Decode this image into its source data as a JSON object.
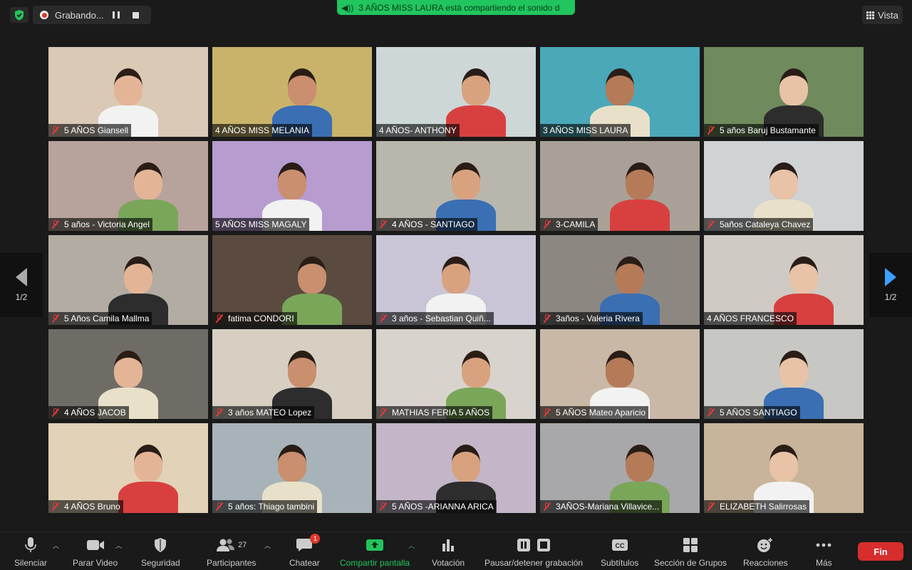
{
  "top": {
    "recording_label": "Grabando...",
    "share_banner": "3 AÑOS MISS LAURA está compartiendo el sonido d",
    "view_label": "Vista"
  },
  "pagination": {
    "left": "1/2",
    "right": "1/2"
  },
  "tiles": [
    {
      "name": "5 AÑOS Giansell",
      "muted": true,
      "bg": "#d9c9b5"
    },
    {
      "name": "4 AÑOS MISS MELANIA",
      "muted": false,
      "bg": "#c9b36a"
    },
    {
      "name": "4 AÑOS- ANTHONY",
      "muted": false,
      "bg": "#cdd7d8"
    },
    {
      "name": "3 AÑOS MISS LAURA",
      "muted": false,
      "bg": "#4aa8b8"
    },
    {
      "name": "5 años Baruj Bustamante",
      "muted": true,
      "bg": "#6f8a5c"
    },
    {
      "name": "5 años - Victoria Angel",
      "muted": true,
      "bg": "#b8a39c"
    },
    {
      "name": "5 AÑOS MISS MAGALY",
      "muted": false,
      "bg": "#b79cd0"
    },
    {
      "name": "4 AÑOS - SANTIAGO",
      "muted": true,
      "bg": "#b9b6ac"
    },
    {
      "name": "3-CAMILA",
      "muted": true,
      "bg": "#a9a197"
    },
    {
      "name": "5años Cataleya Chavez",
      "muted": true,
      "bg": "#cfd3d6"
    },
    {
      "name": "5 Años Camila Mallma",
      "muted": true,
      "bg": "#b3aca3"
    },
    {
      "name": "fatima CONDORI",
      "muted": true,
      "bg": "#5a4a40"
    },
    {
      "name": "3 años - Sebastian Quiñ...",
      "muted": true,
      "bg": "#c9c4d6"
    },
    {
      "name": "3años - Valeria Rivera",
      "muted": true,
      "bg": "#8d8782"
    },
    {
      "name": "4 AÑOS FRANCESCO",
      "muted": false,
      "bg": "#cfcac4"
    },
    {
      "name": "4 AÑOS JACOB",
      "muted": true,
      "bg": "#6f6c66"
    },
    {
      "name": "3 años MATEO  Lopez",
      "muted": true,
      "bg": "#d6cfc2"
    },
    {
      "name": "MATHIAS FERIA 5 AÑOS",
      "muted": true,
      "bg": "#d8d3cc"
    },
    {
      "name": "5 AÑOS Mateo Aparicio",
      "muted": true,
      "bg": "#c9b8a6"
    },
    {
      "name": "5 AÑOS SANTIAGO",
      "muted": true,
      "bg": "#c7c7c3"
    },
    {
      "name": "4 AÑOS Bruno",
      "muted": true,
      "bg": "#e2d2b8"
    },
    {
      "name": "5 años: Thiago tambini",
      "muted": true,
      "bg": "#a7b3b8"
    },
    {
      "name": "5 AÑOS -ARIANNA ARICA",
      "muted": true,
      "bg": "#c3b6c8"
    },
    {
      "name": "3AÑOS-Mariana Villavice...",
      "muted": true,
      "bg": "#a8a8aa"
    },
    {
      "name": "ELIZABETH Salirrosas",
      "muted": true,
      "bg": "#c8b49a"
    }
  ],
  "toolbar": {
    "mute": "Silenciar",
    "video": "Parar Video",
    "security": "Seguridad",
    "participants": "Participantes",
    "participants_count": "27",
    "chat": "Chatear",
    "chat_badge": "1",
    "share": "Compartir pantalla",
    "poll": "Votación",
    "record": "Pausar/detener grabación",
    "subtitles": "Subtítulos",
    "rooms": "Sección de Grupos",
    "reactions": "Reacciones",
    "more": "Más",
    "end": "Fin"
  }
}
